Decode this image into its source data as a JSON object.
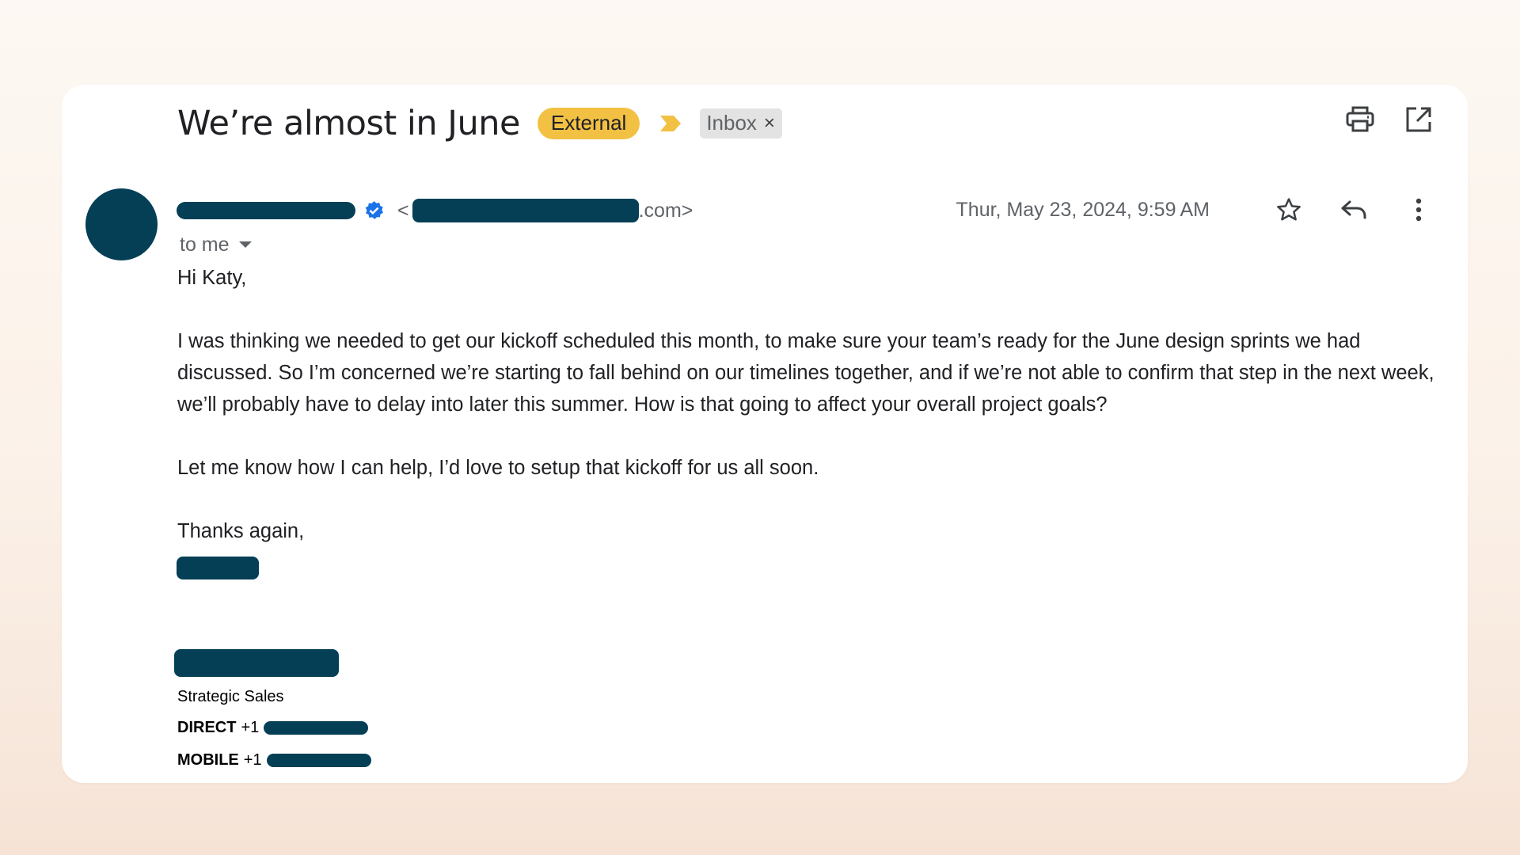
{
  "email": {
    "subject": "We’re almost in June",
    "labels": {
      "external": "External",
      "inbox": "Inbox",
      "remove": "×"
    },
    "sender": {
      "address_open": "<",
      "address_suffix": ".com>",
      "recipient": "to me"
    },
    "date": "Thur, May 23, 2024, 9:59 AM",
    "body": {
      "greeting": "Hi Katy,",
      "paragraph1": "I was thinking we needed to get our kickoff scheduled this month, to make sure your team’s ready for the June design sprints we had discussed. So I’m concerned we’re starting to fall behind on our timelines together, and if we’re not able to confirm that step in the next week, we’ll probably have to delay into later this summer. How is that going to affect your overall project goals?",
      "paragraph2": "Let me know how I can help, I’d love to setup that kickoff for us all soon.",
      "closing": "Thanks again,"
    },
    "signature": {
      "title": "Strategic Sales",
      "direct_label": "DIRECT",
      "direct_prefix": "+1",
      "mobile_label": "MOBILE",
      "mobile_prefix": "+1"
    }
  },
  "icons": {
    "print": "print-icon",
    "open_new_window": "open-in-new-window-icon",
    "star": "star-icon",
    "reply": "reply-icon",
    "more": "more-vert-icon",
    "verified": "verified-badge-icon",
    "importance": "importance-marker-icon",
    "dropdown": "caret-down-icon"
  },
  "colors": {
    "avatar": "#043f55",
    "redaction": "#043f55",
    "external_label": "#f2c144",
    "inbox_label": "#e3e3e3",
    "verified": "#1a73e8",
    "importance": "#f2c144"
  }
}
